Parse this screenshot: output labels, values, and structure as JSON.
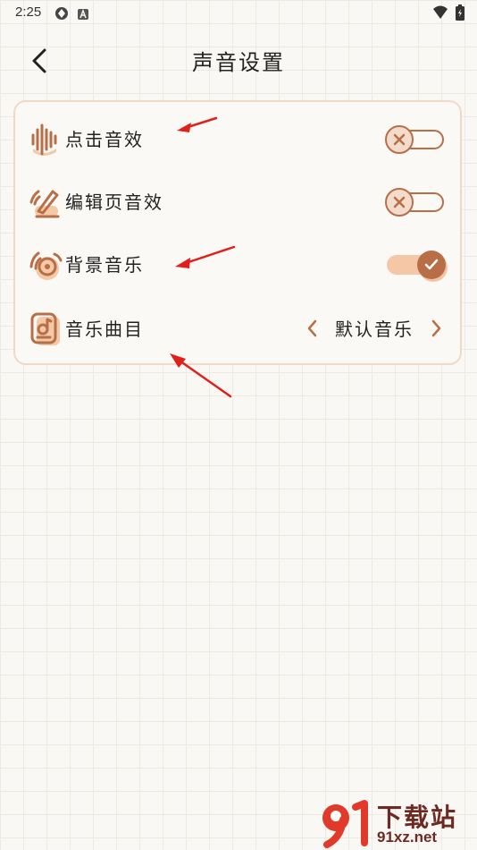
{
  "status_bar": {
    "time": "2:25"
  },
  "header": {
    "title": "声音设置"
  },
  "settings": {
    "click_sound": {
      "label": "点击音效",
      "enabled": false
    },
    "edit_page_sound": {
      "label": "编辑页音效",
      "enabled": false
    },
    "background_music": {
      "label": "背景音乐",
      "enabled": true
    },
    "music_track": {
      "label": "音乐曲目",
      "value": "默认音乐"
    }
  },
  "watermark": {
    "title": "下载站",
    "url": "91xz.net"
  },
  "colors": {
    "accent": "#b86f47",
    "accent_light": "#f6c7a6",
    "card_border": "#f3d9c4",
    "annotation_arrow": "#e0201a"
  }
}
